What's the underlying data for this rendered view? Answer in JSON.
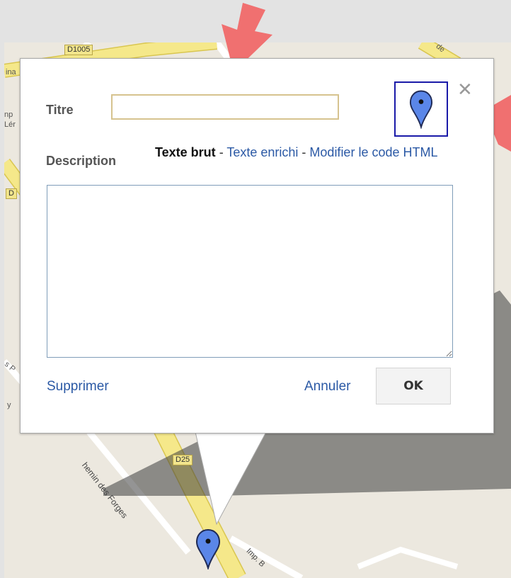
{
  "map": {
    "road_labels": {
      "d1005": "D1005",
      "d25": "D25",
      "d_partial": "D"
    },
    "street_labels": {
      "chemin_des_forges": "hemin des Forges",
      "imp": "Imp. B",
      "de": "de",
      "left_top": "ina",
      "left_mid1": "np",
      "left_mid2": "Lér",
      "left_low1": "s P",
      "left_low2": "y"
    }
  },
  "dialog": {
    "title_label": "Titre",
    "title_value": "",
    "description_label": "Description",
    "modes": {
      "plain": "Texte brut",
      "sep": " - ",
      "rich": "Texte enrichi",
      "html": "Modifier le code HTML"
    },
    "description_value": "",
    "delete_label": "Supprimer",
    "cancel_label": "Annuler",
    "ok_label": "OK",
    "close_glyph": "✕"
  },
  "colors": {
    "accent_link": "#2b59a5",
    "icon_border": "#1a1aa8",
    "marker_fill": "#5a86e8",
    "arrow": "#f07070"
  }
}
